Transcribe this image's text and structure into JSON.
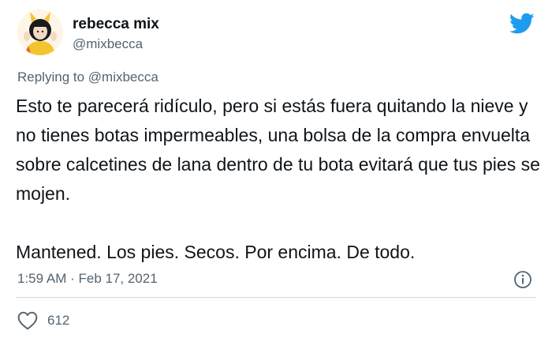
{
  "author": {
    "name": "rebecca mix",
    "handle": "@mixbecca"
  },
  "reply": {
    "prefix": "Replying to ",
    "mention": "@mixbecca"
  },
  "tweet": {
    "paragraph_1": "Esto te parecerá ridículo, pero si estás fuera quitando la nieve y no tienes botas impermeables, una bolsa de la compra envuelta sobre calcetines de lana dentro de tu bota evitará que tus pies se mojen.",
    "paragraph_2": "Mantened. Los pies. Secos. Por encima. De todo."
  },
  "meta": {
    "timestamp": "1:59 AM · Feb 17, 2021"
  },
  "actions": {
    "like_count": "612"
  },
  "icons": {
    "brand": "twitter-bird-icon",
    "info": "info-icon",
    "like": "heart-icon"
  },
  "colors": {
    "twitter_blue": "#1d9bf0",
    "text": "#0f1419",
    "secondary": "#536471",
    "divider": "#cfd9de"
  }
}
